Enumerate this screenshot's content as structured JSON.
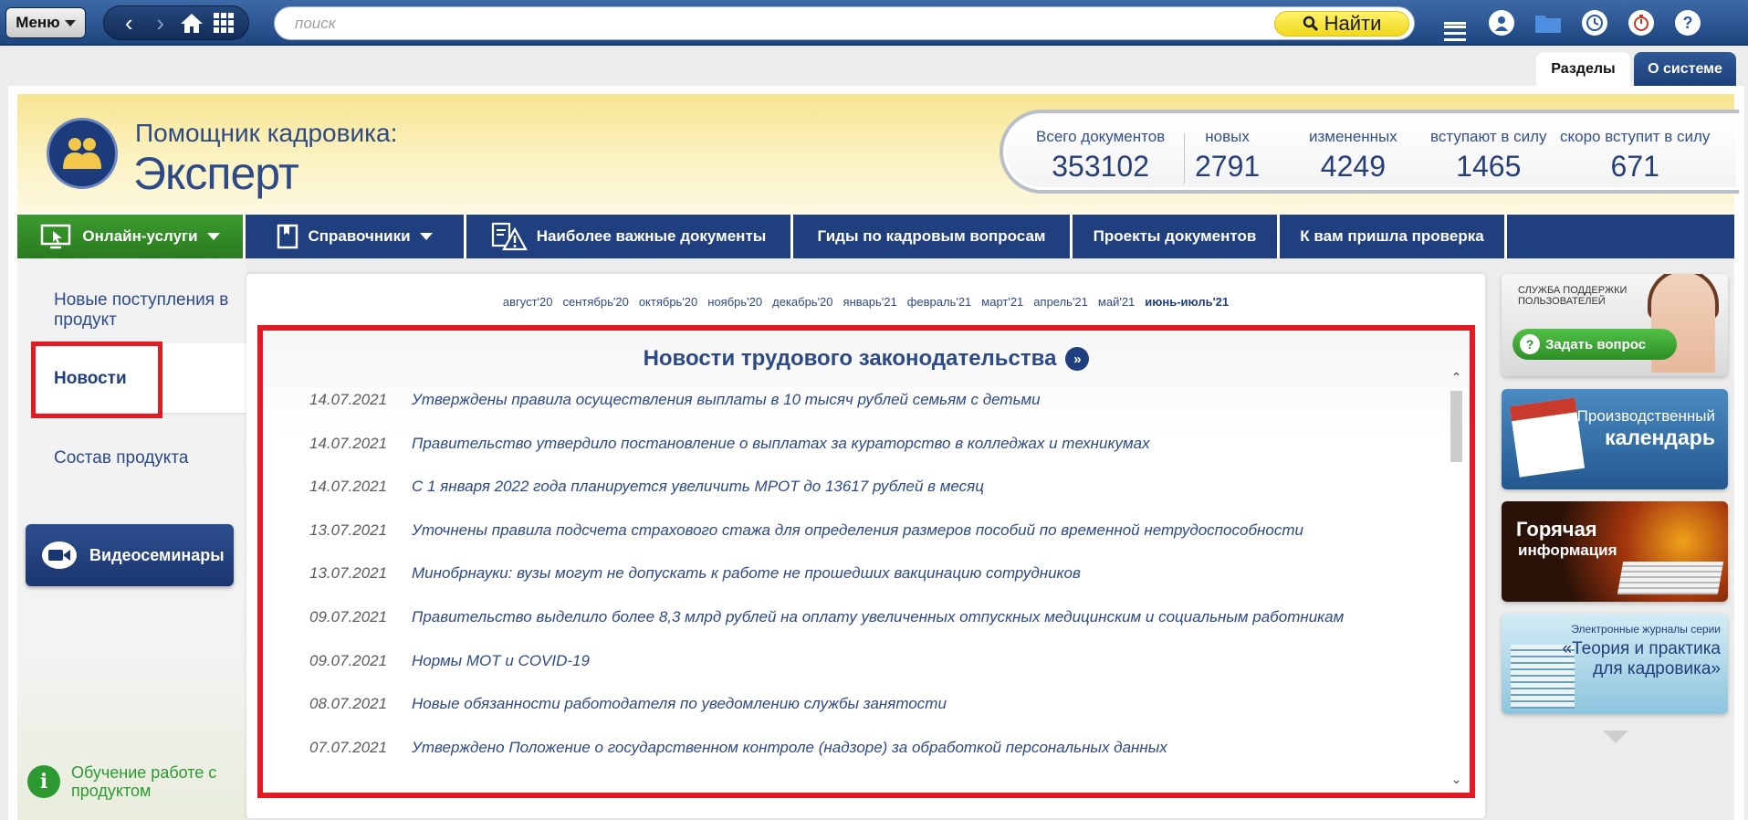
{
  "topbar": {
    "menu_label": "Меню",
    "search_placeholder": "поиск",
    "find_label": "Найти"
  },
  "tabs": [
    {
      "label": "Разделы",
      "active": true
    },
    {
      "label": "О системе",
      "active": false
    }
  ],
  "header": {
    "subtitle": "Помощник кадровика:",
    "title": "Эксперт",
    "stats": [
      {
        "label": "Всего документов",
        "value": "353102"
      },
      {
        "label": "новых",
        "value": "2791"
      },
      {
        "label": "измененных",
        "value": "4249"
      },
      {
        "label": "вступают в силу",
        "value": "1465"
      },
      {
        "label": "скоро вступит в силу",
        "value": "671"
      }
    ]
  },
  "main_nav": [
    {
      "label": "Онлайн-услуги",
      "icon": "monitor-cursor-icon",
      "dropdown": true
    },
    {
      "label": "Справочники",
      "icon": "book-icon",
      "dropdown": true
    },
    {
      "label": "Наиболее важные документы",
      "icon": "warning-document-icon",
      "dropdown": false
    },
    {
      "label": "Гиды по кадровым вопросам",
      "dropdown": false
    },
    {
      "label": "Проекты документов",
      "dropdown": false
    },
    {
      "label": "К вам пришла проверка",
      "dropdown": false
    }
  ],
  "sidebar": {
    "items": [
      {
        "label": "Новые поступления в продукт"
      },
      {
        "label": "Новости",
        "active": true
      },
      {
        "label": "Состав продукта"
      }
    ],
    "video_button": "Видеосеминары",
    "training_label": "Обучение работе с продуктом"
  },
  "months": [
    "август'20",
    "сентябрь'20",
    "октябрь'20",
    "ноябрь'20",
    "декабрь'20",
    "январь'21",
    "февраль'21",
    "март'21",
    "апрель'21",
    "май'21",
    "июнь-июль'21"
  ],
  "current_month": "июнь-июль'21",
  "news": {
    "title": "Новости трудового законодательства",
    "items": [
      {
        "date": "14.07.2021",
        "text": "Утверждены правила осуществления выплаты в 10 тысяч рублей семьям с детьми"
      },
      {
        "date": "14.07.2021",
        "text": "Правительство утвердило постановление о выплатах за кураторство в колледжах и техникумах"
      },
      {
        "date": "14.07.2021",
        "text": "С 1 января 2022 года планируется увеличить МРОТ до 13617 рублей в месяц"
      },
      {
        "date": "13.07.2021",
        "text": "Уточнены правила подсчета страхового стажа для определения размеров пособий по временной нетрудоспособности"
      },
      {
        "date": "13.07.2021",
        "text": "Минобрнауки: вузы могут не допускать к работе не прошедших вакцинацию сотрудников"
      },
      {
        "date": "09.07.2021",
        "text": "Правительство выделило более 8,3 млрд рублей на оплату увеличенных отпускных медицинским и социальным работникам"
      },
      {
        "date": "09.07.2021",
        "text": "Нормы МОТ и COVID-19"
      },
      {
        "date": "08.07.2021",
        "text": "Новые обязанности работодателя по уведомлению службы занятости"
      },
      {
        "date": "07.07.2021",
        "text": "Утверждено Положение о государственном контроле (надзоре) за обработкой персональных данных"
      }
    ]
  },
  "banners": {
    "support": {
      "small": "Служба поддержки пользователей",
      "button": "Задать вопрос"
    },
    "calendar": {
      "line1": "Производственный",
      "line2": "календарь"
    },
    "hot": {
      "line1": "Горячая",
      "line2": "информация"
    },
    "journals": {
      "line1": "Электронные журналы серии",
      "line2": "«Теория и практика для кадровика»"
    }
  },
  "colors": {
    "accent_red": "#e11b24",
    "nav_blue": "#203f7e",
    "green": "#2a7b1f",
    "find_yellow": "#f1d81d"
  }
}
